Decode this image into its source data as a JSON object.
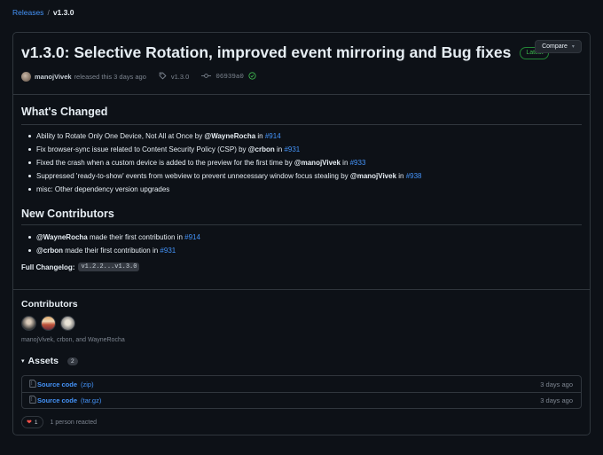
{
  "breadcrumb": {
    "parent": "Releases",
    "separator": "/",
    "current": "v1.3.0"
  },
  "release": {
    "title": "v1.3.0: Selective Rotation, improved event mirroring and Bug fixes",
    "badge": "Latest",
    "compare_label": "Compare",
    "author": "manojVivek",
    "released_text": "released this 3 days ago",
    "tag": "v1.3.0",
    "commit": "06939a0"
  },
  "whats_changed": {
    "heading": "What's Changed",
    "items": [
      {
        "text": "Ability to Rotate Only One Device, Not All at Once by ",
        "user": "@WayneRocha",
        "in": " in ",
        "pr": "#914"
      },
      {
        "text": "Fix browser-sync issue related to Content Security Policy (CSP) by ",
        "user": "@crbon",
        "in": " in ",
        "pr": "#931"
      },
      {
        "text": "Fixed the crash when a custom device is added to the preview for the first time by ",
        "user": "@manojVivek",
        "in": " in ",
        "pr": "#933"
      },
      {
        "text": "Suppressed 'ready-to-show' events from webview to prevent unnecessary window focus stealing by ",
        "user": "@manojVivek",
        "in": " in ",
        "pr": "#938"
      },
      {
        "text": "misc: Other dependency version upgrades"
      }
    ]
  },
  "new_contributors": {
    "heading": "New Contributors",
    "items": [
      {
        "user": "@WayneRocha",
        "text": " made their first contribution in ",
        "pr": "#914"
      },
      {
        "user": "@crbon",
        "text": " made their first contribution in ",
        "pr": "#931"
      }
    ]
  },
  "changelog": {
    "label": "Full Changelog:",
    "range": "v1.2.2...v1.3.0"
  },
  "contributors": {
    "heading": "Contributors",
    "names": "manojVivek, crbon, and WayneRocha"
  },
  "assets": {
    "heading": "Assets",
    "count": "2",
    "items": [
      {
        "name": "Source code",
        "ext": "(zip)",
        "time": "3 days ago"
      },
      {
        "name": "Source code",
        "ext": "(tar.gz)",
        "time": "3 days ago"
      }
    ]
  },
  "reactions": {
    "emoji_icon": "heart-icon",
    "count": "1",
    "text": "1 person reacted"
  },
  "colors": {
    "background": "#0d1117",
    "border": "#30363d",
    "link": "#4493f8",
    "success": "#3fb950"
  }
}
